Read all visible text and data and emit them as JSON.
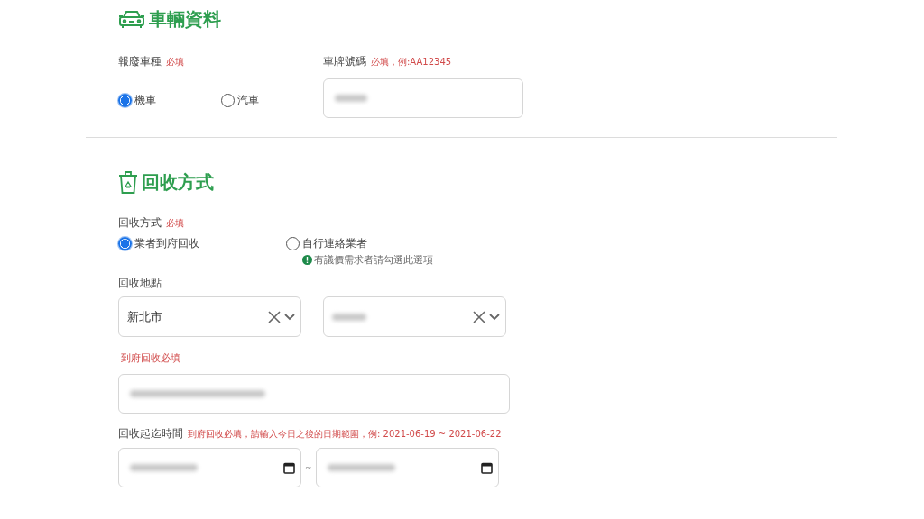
{
  "vehicle_section": {
    "title": "車輛資料",
    "vehicle_type": {
      "label": "報廢車種",
      "required": "必填",
      "options": [
        {
          "label": "機車",
          "selected": true
        },
        {
          "label": "汽車",
          "selected": false
        }
      ]
    },
    "plate": {
      "label": "車牌號碼",
      "hint": "必填，例:AA12345"
    }
  },
  "recycle_section": {
    "title": "回收方式",
    "method": {
      "label": "回收方式",
      "required": "必填",
      "options": [
        {
          "label": "業者到府回收",
          "selected": true
        },
        {
          "label": "自行連絡業者",
          "selected": false,
          "note": "有議價需求者請勾選此選項"
        }
      ]
    },
    "location": {
      "label": "回收地點",
      "city": {
        "value": "新北市"
      },
      "hint": "到府回收必填"
    },
    "period": {
      "label": "回收起迄時間",
      "hint": "到府回收必填，請輸入今日之後的日期範圍，例: 2021-06-19 ~ 2021-06-22",
      "separator": "~"
    }
  }
}
